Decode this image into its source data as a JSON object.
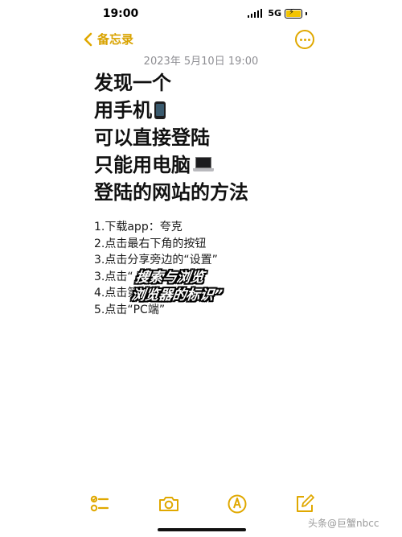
{
  "status_bar": {
    "time": "19:00",
    "network": "5G"
  },
  "nav": {
    "back_label": "备忘录",
    "back_icon": "chevron-left-icon",
    "more_icon": "ellipsis-circle-icon",
    "accent_color": "#e0a800"
  },
  "note": {
    "date": "2023年 5月10日 19:00",
    "title_lines": [
      "发现一个",
      "用手机",
      "可以直接登陆",
      "只能用电脑",
      "登陆的网站的方法"
    ],
    "steps": [
      "1.下载app：夸克",
      "2.点击最右下角的按钮",
      "3.点击分享旁边的“设置”",
      "3.点击“",
      "4.点击第",
      "5.点击“PC端”"
    ],
    "overlay_lines": [
      "搜索与浏览",
      "浏览器的标识”"
    ]
  },
  "toolbar": {
    "items": [
      "checklist-icon",
      "camera-icon",
      "markup-pen-icon",
      "compose-icon"
    ]
  },
  "watermark": "头条@巨蟹nbcc"
}
